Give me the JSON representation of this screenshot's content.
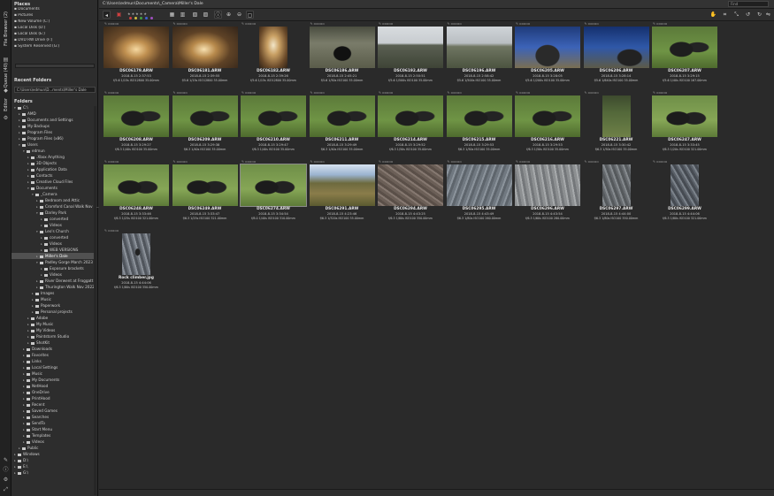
{
  "window": {
    "path": "C:\\Users\\edmun\\Documents\\_Camera\\Miller's Dale"
  },
  "vtabs": [
    "File Browser (2)",
    "Queue (40)",
    "Editor"
  ],
  "places": {
    "title": "Places",
    "items": [
      "Documents",
      "Pictures",
      "New Volume (C:)",
      "Local Disk (D:)",
      "Local Disk (E:)",
      "DVD RW Drive (F:)",
      "System Reserved (G:)"
    ]
  },
  "recent": {
    "title": "Recent Folders",
    "value": "C:\\Users\\edmun\\D...ments\\Miller's Dale"
  },
  "folders": {
    "title": "Folders",
    "tree": [
      {
        "label": "C:\\",
        "indent": 0,
        "expanded": true
      },
      {
        "label": "AMD",
        "indent": 1
      },
      {
        "label": "Documents and Settings",
        "indent": 1
      },
      {
        "label": "My Backups",
        "indent": 1
      },
      {
        "label": "Program Files",
        "indent": 1
      },
      {
        "label": "Program Files (x86)",
        "indent": 1
      },
      {
        "label": "Users",
        "indent": 1,
        "expanded": true
      },
      {
        "label": "edmun",
        "indent": 2,
        "expanded": true
      },
      {
        "label": ".Xbox Anything",
        "indent": 3
      },
      {
        "label": "3D Objects",
        "indent": 3
      },
      {
        "label": "Application Data",
        "indent": 3
      },
      {
        "label": "Contacts",
        "indent": 3
      },
      {
        "label": "Creative Cloud Files",
        "indent": 3
      },
      {
        "label": "Documents",
        "indent": 3,
        "expanded": true
      },
      {
        "label": "_Camera",
        "indent": 4,
        "expanded": true
      },
      {
        "label": "Bedroom and Attic",
        "indent": 5
      },
      {
        "label": "Cromford Canal Walk Nov 2...",
        "indent": 5
      },
      {
        "label": "Darley Park",
        "indent": 5,
        "expanded": true
      },
      {
        "label": "converted",
        "indent": 6
      },
      {
        "label": "Videos",
        "indent": 6
      },
      {
        "label": "Leo's Church",
        "indent": 5,
        "expanded": true
      },
      {
        "label": "converted",
        "indent": 6
      },
      {
        "label": "Videos",
        "indent": 6
      },
      {
        "label": "WEB VERSIONS",
        "indent": 6
      },
      {
        "label": "Miller's Dale",
        "indent": 5,
        "selected": true
      },
      {
        "label": "Padley Gorge March 2023",
        "indent": 5,
        "expanded": true
      },
      {
        "label": "Exposure brackets",
        "indent": 6
      },
      {
        "label": "Videos",
        "indent": 6
      },
      {
        "label": "River Derwent at Froggatt",
        "indent": 5
      },
      {
        "label": "Thurington Walk Nov 2022",
        "indent": 5
      },
      {
        "label": "Images",
        "indent": 4
      },
      {
        "label": "Music",
        "indent": 4
      },
      {
        "label": "Paperwork",
        "indent": 4
      },
      {
        "label": "Personal projects",
        "indent": 4
      },
      {
        "label": "Adobe",
        "indent": 3
      },
      {
        "label": "My Music",
        "indent": 3
      },
      {
        "label": "My Videos",
        "indent": 3
      },
      {
        "label": "Paintstorm Studio",
        "indent": 3
      },
      {
        "label": "ShotKit",
        "indent": 3
      },
      {
        "label": "Downloads",
        "indent": 2
      },
      {
        "label": "Favorites",
        "indent": 2
      },
      {
        "label": "Links",
        "indent": 2
      },
      {
        "label": "Local Settings",
        "indent": 2
      },
      {
        "label": "Music",
        "indent": 2
      },
      {
        "label": "My Documents",
        "indent": 2
      },
      {
        "label": "NetHood",
        "indent": 2
      },
      {
        "label": "OneDrive",
        "indent": 2
      },
      {
        "label": "PrintHood",
        "indent": 2
      },
      {
        "label": "Recent",
        "indent": 2
      },
      {
        "label": "Saved Games",
        "indent": 2
      },
      {
        "label": "Searches",
        "indent": 2
      },
      {
        "label": "SendTo",
        "indent": 2
      },
      {
        "label": "Start Menu",
        "indent": 2
      },
      {
        "label": "Templates",
        "indent": 2
      },
      {
        "label": "Videos",
        "indent": 2
      },
      {
        "label": "Public",
        "indent": 1
      },
      {
        "label": "Windows",
        "indent": 0
      },
      {
        "label": "D:\\",
        "indent": 0
      },
      {
        "label": "E:\\",
        "indent": 0
      },
      {
        "label": "G:\\",
        "indent": 0
      }
    ]
  },
  "toolbar": {
    "find_placeholder": "Find",
    "stars": "★★★★★",
    "colors": [
      "#d04040",
      "#d0c040",
      "#40a040",
      "#4060d0",
      "#a050c0"
    ]
  },
  "thumbs": [
    {
      "name": "DSC06179.ARW",
      "date": "2018-8-15 2:37:53",
      "exif": "f/5.6 1/15s ISO12800 35.00mm",
      "style": "t-tunnel1",
      "w": 74,
      "h": 47
    },
    {
      "name": "DSC06181.ARW",
      "date": "2018-8-15 2:39:55",
      "exif": "f/5.6 1/15s ISO12800 35.00mm",
      "style": "t-tunnel2",
      "w": 74,
      "h": 47
    },
    {
      "name": "DSC06182.ARW",
      "date": "2018-8-15 2:39:26",
      "exif": "f/5.6 1/15s ISO12800 35.00mm",
      "style": "t-tunnel3",
      "w": 32,
      "h": 47
    },
    {
      "name": "DSC06186.ARW",
      "date": "2018-8-15 2:45:21",
      "exif": "f/5.6 1/50s ISO100 35.00mm",
      "style": "t-stone",
      "w": 74,
      "h": 47
    },
    {
      "name": "DSC06192.ARW",
      "date": "2018-8-15 2:50:51",
      "exif": "f/5.6 1/500s ISO100 35.00mm",
      "style": "t-hill1",
      "w": 74,
      "h": 47
    },
    {
      "name": "DSC06196.ARW",
      "date": "2018-8-15 2:58:42",
      "exif": "f/5.6 1/500s ISO100 35.00mm",
      "style": "t-hill2",
      "w": 74,
      "h": 47
    },
    {
      "name": "DSC06205.ARW",
      "date": "2018-8-15 3:28:05",
      "exif": "f/5.6 1/200s ISO100 35.00mm",
      "style": "t-person1",
      "w": 74,
      "h": 47
    },
    {
      "name": "DSC06206.ARW",
      "date": "2018-8-15 3:28:14",
      "exif": "f/5.6 1/640s ISO100 35.00mm",
      "style": "t-person2",
      "w": 74,
      "h": 47
    },
    {
      "name": "DSC06207.ARW",
      "date": "2018-8-15 3:29:15",
      "exif": "f/5.6 1/40s ISO100 167.00mm",
      "style": "t-pig",
      "w": 74,
      "h": 47
    },
    {
      "name": "DSC06208.ARW",
      "date": "2018-8-15 3:29:27",
      "exif": "f/6.3 1/40s ISO100 35.00mm",
      "style": "t-pig",
      "w": 74,
      "h": 47
    },
    {
      "name": "DSC06209.ARW",
      "date": "2018-8-15 3:29:38",
      "exif": "f/6.3 1/40s ISO100 35.00mm",
      "style": "t-pig",
      "w": 74,
      "h": 47
    },
    {
      "name": "DSC06210.ARW",
      "date": "2018-8-15 3:29:47",
      "exif": "f/6.3 1/40s ISO100 35.00mm",
      "style": "t-pig",
      "w": 74,
      "h": 47
    },
    {
      "name": "DSC06211.ARW",
      "date": "2018-8-15 3:29:49",
      "exif": "f/6.3 1/40s ISO100 35.00mm",
      "style": "t-pig",
      "w": 74,
      "h": 47
    },
    {
      "name": "DSC06214.ARW",
      "date": "2018-8-15 3:29:52",
      "exif": "f/6.3 1/50s ISO100 35.00mm",
      "style": "t-pig",
      "w": 74,
      "h": 47
    },
    {
      "name": "DSC06215.ARW",
      "date": "2018-8-15 3:29:53",
      "exif": "f/6.3 1/50s ISO100 35.00mm",
      "style": "t-pig",
      "w": 74,
      "h": 47
    },
    {
      "name": "DSC06216.ARW",
      "date": "2018-8-15 3:29:53",
      "exif": "f/6.3 1/50s ISO100 35.00mm",
      "style": "t-pig",
      "w": 74,
      "h": 47
    },
    {
      "name": "DSC06221.ARW",
      "date": "2018-8-15 3:30:42",
      "exif": "f/6.3 1/50s ISO100 35.00mm",
      "style": "t-field",
      "w": 32,
      "h": 47
    },
    {
      "name": "DSC06247.ARW",
      "date": "2018-8-15 3:33:45",
      "exif": "f/6.3 1/20s ISO100 321.00mm",
      "style": "t-pig2",
      "w": 74,
      "h": 47
    },
    {
      "name": "DSC06248.ARW",
      "date": "2018-8-15 3:33:46",
      "exif": "f/6.3 1/25s ISO100 321.00mm",
      "style": "t-pig2",
      "w": 74,
      "h": 47
    },
    {
      "name": "DSC06249.ARW",
      "date": "2018-8-15 3:33:47",
      "exif": "f/6.3 1/25s ISO100 321.00mm",
      "style": "t-pig2",
      "w": 74,
      "h": 47
    },
    {
      "name": "DSC06274.ARW",
      "date": "2018-8-15 3:34:54",
      "exif": "f/8.0 1/40s ISO100 310.00mm",
      "style": "t-pig2",
      "w": 74,
      "h": 47
    },
    {
      "name": "DSC06291.ARW",
      "date": "2018-8-15 4:23:46",
      "exif": "f/6.3 1/320s ISO100 35.00mm",
      "style": "t-valley",
      "w": 74,
      "h": 47
    },
    {
      "name": "DSC06294.ARW",
      "date": "2018-8-15 4:43:25",
      "exif": "f/6.3 1/80s ISO100 350.00mm",
      "style": "t-rock1",
      "w": 74,
      "h": 47
    },
    {
      "name": "DSC06295.ARW",
      "date": "2018-8-15 4:43:49",
      "exif": "f/6.3 1/80s ISO100 260.00mm",
      "style": "t-rock2",
      "w": 74,
      "h": 47
    },
    {
      "name": "DSC06296.ARW",
      "date": "2018-8-15 4:43:54",
      "exif": "f/6.3 1/60s ISO100 280.00mm",
      "style": "t-rock3",
      "w": 74,
      "h": 47
    },
    {
      "name": "DSC06297.ARW",
      "date": "2018-8-15 4:44:00",
      "exif": "f/6.3 1/80s ISO100 350.00mm",
      "style": "t-rock4",
      "w": 32,
      "h": 47
    },
    {
      "name": "DSC06299.ARW",
      "date": "2018-8-15 4:44:06",
      "exif": "f/6.3 1/80s ISO100 321.00mm",
      "style": "t-rock5",
      "w": 32,
      "h": 47
    },
    {
      "name": "Rock climber.jpg",
      "date": "2018-8-15 4:44:06",
      "exif": "f/6.3 1/80s ISO100 350.00mm",
      "style": "t-climber",
      "w": 32,
      "h": 47
    }
  ],
  "selected_thumb": 20
}
